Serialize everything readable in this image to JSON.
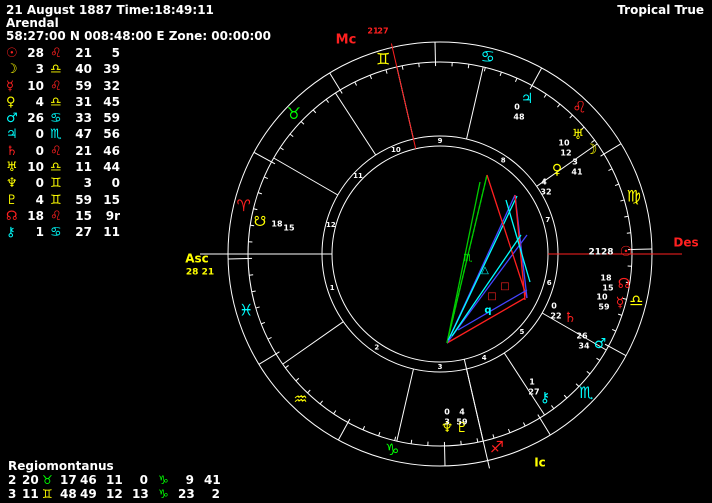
{
  "header": {
    "date_line": "21 August 1887 Time:18:49:11",
    "place": "Arendal",
    "coords": "58:27:00 N 008:48:00 E Zone: 00:00:00",
    "mode": "Tropical True"
  },
  "planets": [
    {
      "glyph": "☉",
      "color": "#ff2020",
      "deg": "28",
      "sign": "♌",
      "scolor": "#ff2020",
      "min": "21",
      "sec": "5"
    },
    {
      "glyph": "☽",
      "color": "#ffff00",
      "deg": "3",
      "sign": "♎",
      "scolor": "#ffff00",
      "min": "40",
      "sec": "39"
    },
    {
      "glyph": "☿",
      "color": "#ff2020",
      "deg": "10",
      "sign": "♌",
      "scolor": "#ff2020",
      "min": "59",
      "sec": "32"
    },
    {
      "glyph": "♀",
      "color": "#ffff00",
      "deg": "4",
      "sign": "♎",
      "scolor": "#ffff00",
      "min": "31",
      "sec": "45"
    },
    {
      "glyph": "♂",
      "color": "#00ffff",
      "deg": "26",
      "sign": "♋",
      "scolor": "#00ffff",
      "min": "33",
      "sec": "59"
    },
    {
      "glyph": "♃",
      "color": "#00ffff",
      "deg": "0",
      "sign": "♏",
      "scolor": "#00ffff",
      "min": "47",
      "sec": "56"
    },
    {
      "glyph": "♄",
      "color": "#ff2020",
      "deg": "0",
      "sign": "♌",
      "scolor": "#ff2020",
      "min": "21",
      "sec": "46"
    },
    {
      "glyph": "♅",
      "color": "#ffff00",
      "deg": "10",
      "sign": "♎",
      "scolor": "#ffff00",
      "min": "11",
      "sec": "44"
    },
    {
      "glyph": "♆",
      "color": "#ffff00",
      "deg": "0",
      "sign": "♊",
      "scolor": "#ffff00",
      "min": "3",
      "sec": "0"
    },
    {
      "glyph": "♇",
      "color": "#ffff00",
      "deg": "4",
      "sign": "♊",
      "scolor": "#ffff00",
      "min": "59",
      "sec": "15"
    },
    {
      "glyph": "☊",
      "color": "#ff2020",
      "deg": "18",
      "sign": "♌",
      "scolor": "#ff2020",
      "min": "15",
      "sec": "9r"
    },
    {
      "glyph": "⚷",
      "color": "#00ffff",
      "deg": "1",
      "sign": "♋",
      "scolor": "#00ffff",
      "min": "27",
      "sec": "11"
    }
  ],
  "houses": {
    "title": "Regiomontanus",
    "rows": [
      {
        "h": "2",
        "deg": "20",
        "sign": "♉",
        "scolor": "#00ff00",
        "min": "17",
        "h2": "46",
        "deg2": "11",
        "min2": "0",
        "sign2": "♑",
        "scolor2": "#00ff00",
        "deg3": "9",
        "min3": "41"
      },
      {
        "h": "3",
        "deg": "11",
        "sign": "♊",
        "scolor": "#ffff00",
        "min": "48",
        "h2": "49",
        "deg2": "12",
        "min2": "13",
        "sign2": "♑",
        "scolor2": "#00ff00",
        "deg3": "23",
        "min3": "2"
      }
    ]
  },
  "chart": {
    "mc_label": "Mc",
    "mc_deg": "21",
    "mc_min": "27",
    "asc_label": "Asc",
    "asc_value": "28 21",
    "des_label": "Des",
    "ic_label": "Ic",
    "des_value": "2128",
    "zodiac": [
      {
        "glyph": "♍",
        "color": "#ffff00"
      },
      {
        "glyph": "♌",
        "color": "#ff2020"
      },
      {
        "glyph": "♋",
        "color": "#00ffff"
      },
      {
        "glyph": "♊",
        "color": "#ffff00"
      },
      {
        "glyph": "♉",
        "color": "#00ff00"
      },
      {
        "glyph": "♈",
        "color": "#ff2020"
      },
      {
        "glyph": "♓",
        "color": "#00ffff"
      },
      {
        "glyph": "♒",
        "color": "#ffff00"
      },
      {
        "glyph": "♑",
        "color": "#00ff00"
      },
      {
        "glyph": "♐",
        "color": "#ff2020"
      },
      {
        "glyph": "♏",
        "color": "#00ffff"
      },
      {
        "glyph": "♎",
        "color": "#ffff00"
      }
    ],
    "house_numbers": [
      "1",
      "2",
      "3",
      "4",
      "5",
      "6",
      "7",
      "8",
      "9",
      "10",
      "11",
      "12"
    ],
    "planet_labels": [
      {
        "glyph": "♃",
        "color": "#00ffff",
        "deg": "0",
        "min": "48"
      },
      {
        "glyph": "☽",
        "color": "#ffff00",
        "deg": "3",
        "min": "41"
      },
      {
        "glyph": "♅",
        "color": "#ffff00",
        "deg": "10",
        "min": "12"
      },
      {
        "glyph": "♀",
        "color": "#ffff00",
        "deg": "4",
        "min": "32"
      },
      {
        "glyph": "☉",
        "color": "#ff2020",
        "deg": "28",
        "min": "21"
      },
      {
        "glyph": "☿",
        "color": "#ff2020",
        "deg": "10",
        "min": "59"
      },
      {
        "glyph": "☊",
        "color": "#ff2020",
        "deg": "18",
        "min": "15"
      },
      {
        "glyph": "♄",
        "color": "#ff2020",
        "deg": "0",
        "min": "22"
      },
      {
        "glyph": "♂",
        "color": "#00ffff",
        "deg": "26",
        "min": "34"
      },
      {
        "glyph": "⚷",
        "color": "#00ffff",
        "deg": "1",
        "min": "27"
      },
      {
        "glyph": "♆",
        "color": "#ffff00",
        "deg": "0",
        "min": "3"
      },
      {
        "glyph": "♇",
        "color": "#ffff00",
        "deg": "4",
        "min": "59"
      },
      {
        "glyph": "☋",
        "color": "#ffff00",
        "deg": "18",
        "min": "15"
      }
    ],
    "aspect_glyphs": [
      {
        "glyph": "♏",
        "color": "#00ff00"
      },
      {
        "glyph": "△",
        "color": "#00ffff"
      },
      {
        "glyph": "□",
        "color": "#ff2020"
      },
      {
        "glyph": "q",
        "color": "#00ffff"
      },
      {
        "glyph": "□",
        "color": "#ff2020"
      }
    ]
  }
}
